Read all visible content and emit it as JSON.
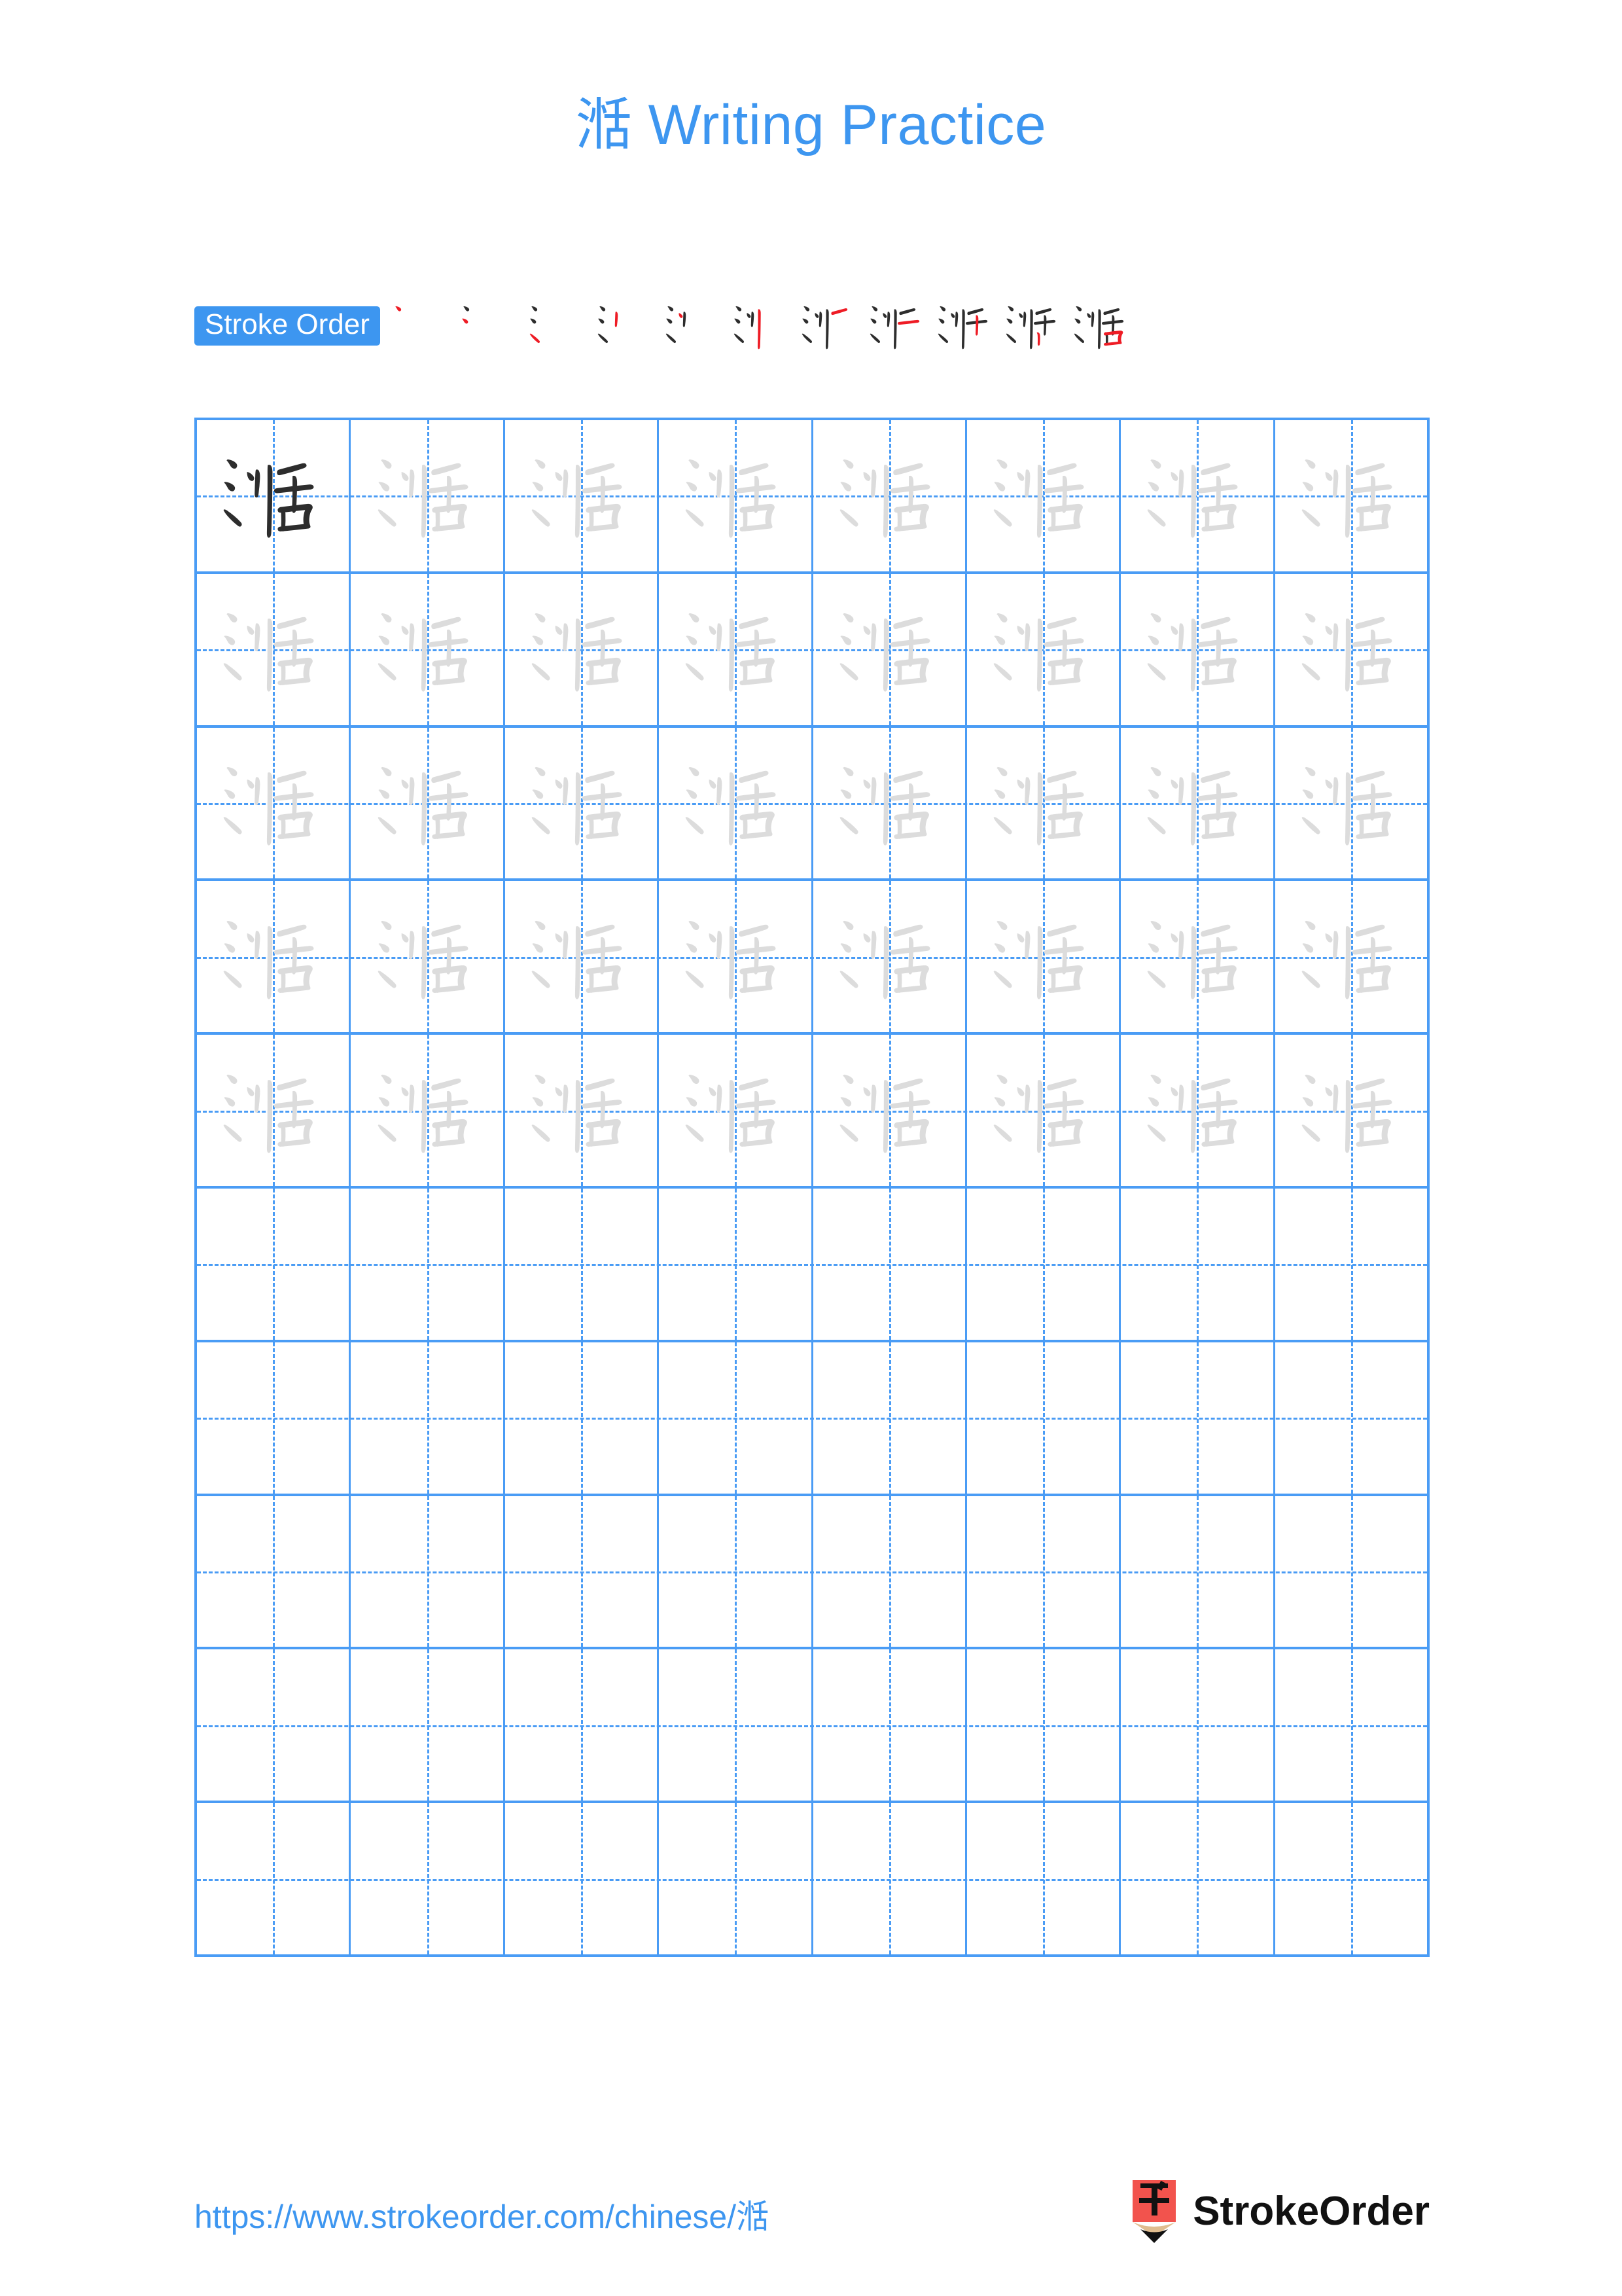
{
  "document": {
    "character": "湉",
    "title": "湉 Writing Practice",
    "title_suffix": " Writing Practice",
    "background_color": "#ffffff",
    "accent_color": "#3d96f0",
    "grid_line_color": "#4a9cf5",
    "trace_char_color": "#dcdcdc",
    "dark_char_color": "#2d2d2d",
    "new_stroke_color": "#ee1c25"
  },
  "stroke_order": {
    "label": "Stroke Order",
    "total_strokes": 11,
    "steps": [
      {
        "index": 1,
        "strokes_shown": 1,
        "new_stroke": 1,
        "label": "stroke-1"
      },
      {
        "index": 2,
        "strokes_shown": 2,
        "new_stroke": 2,
        "label": "stroke-2"
      },
      {
        "index": 3,
        "strokes_shown": 3,
        "new_stroke": 3,
        "label": "stroke-3"
      },
      {
        "index": 4,
        "strokes_shown": 4,
        "new_stroke": 4,
        "label": "stroke-4"
      },
      {
        "index": 5,
        "strokes_shown": 5,
        "new_stroke": 5,
        "label": "stroke-5"
      },
      {
        "index": 6,
        "strokes_shown": 6,
        "new_stroke": 6,
        "label": "stroke-6"
      },
      {
        "index": 7,
        "strokes_shown": 7,
        "new_stroke": 7,
        "label": "stroke-7"
      },
      {
        "index": 8,
        "strokes_shown": 8,
        "new_stroke": 8,
        "label": "stroke-8"
      },
      {
        "index": 9,
        "strokes_shown": 9,
        "new_stroke": 9,
        "label": "stroke-9"
      },
      {
        "index": 10,
        "strokes_shown": 10,
        "new_stroke": 10,
        "label": "stroke-10"
      },
      {
        "index": 11,
        "strokes_shown": 11,
        "new_stroke": 11,
        "label": "stroke-11"
      }
    ]
  },
  "practice_grid": {
    "columns": 8,
    "rows": 10,
    "traced_rows": 5,
    "empty_rows": 5,
    "first_cell_style": "dark",
    "cells": [
      [
        {
          "char": "湉",
          "style": "dark"
        },
        {
          "char": "湉",
          "style": "trace"
        },
        {
          "char": "湉",
          "style": "trace"
        },
        {
          "char": "湉",
          "style": "trace"
        },
        {
          "char": "湉",
          "style": "trace"
        },
        {
          "char": "湉",
          "style": "trace"
        },
        {
          "char": "湉",
          "style": "trace"
        },
        {
          "char": "湉",
          "style": "trace"
        }
      ],
      [
        {
          "char": "湉",
          "style": "trace"
        },
        {
          "char": "湉",
          "style": "trace"
        },
        {
          "char": "湉",
          "style": "trace"
        },
        {
          "char": "湉",
          "style": "trace"
        },
        {
          "char": "湉",
          "style": "trace"
        },
        {
          "char": "湉",
          "style": "trace"
        },
        {
          "char": "湉",
          "style": "trace"
        },
        {
          "char": "湉",
          "style": "trace"
        }
      ],
      [
        {
          "char": "湉",
          "style": "trace"
        },
        {
          "char": "湉",
          "style": "trace"
        },
        {
          "char": "湉",
          "style": "trace"
        },
        {
          "char": "湉",
          "style": "trace"
        },
        {
          "char": "湉",
          "style": "trace"
        },
        {
          "char": "湉",
          "style": "trace"
        },
        {
          "char": "湉",
          "style": "trace"
        },
        {
          "char": "湉",
          "style": "trace"
        }
      ],
      [
        {
          "char": "湉",
          "style": "trace"
        },
        {
          "char": "湉",
          "style": "trace"
        },
        {
          "char": "湉",
          "style": "trace"
        },
        {
          "char": "湉",
          "style": "trace"
        },
        {
          "char": "湉",
          "style": "trace"
        },
        {
          "char": "湉",
          "style": "trace"
        },
        {
          "char": "湉",
          "style": "trace"
        },
        {
          "char": "湉",
          "style": "trace"
        }
      ],
      [
        {
          "char": "湉",
          "style": "trace"
        },
        {
          "char": "湉",
          "style": "trace"
        },
        {
          "char": "湉",
          "style": "trace"
        },
        {
          "char": "湉",
          "style": "trace"
        },
        {
          "char": "湉",
          "style": "trace"
        },
        {
          "char": "湉",
          "style": "trace"
        },
        {
          "char": "湉",
          "style": "trace"
        },
        {
          "char": "湉",
          "style": "trace"
        }
      ],
      [
        {
          "char": "",
          "style": "empty"
        },
        {
          "char": "",
          "style": "empty"
        },
        {
          "char": "",
          "style": "empty"
        },
        {
          "char": "",
          "style": "empty"
        },
        {
          "char": "",
          "style": "empty"
        },
        {
          "char": "",
          "style": "empty"
        },
        {
          "char": "",
          "style": "empty"
        },
        {
          "char": "",
          "style": "empty"
        }
      ],
      [
        {
          "char": "",
          "style": "empty"
        },
        {
          "char": "",
          "style": "empty"
        },
        {
          "char": "",
          "style": "empty"
        },
        {
          "char": "",
          "style": "empty"
        },
        {
          "char": "",
          "style": "empty"
        },
        {
          "char": "",
          "style": "empty"
        },
        {
          "char": "",
          "style": "empty"
        },
        {
          "char": "",
          "style": "empty"
        }
      ],
      [
        {
          "char": "",
          "style": "empty"
        },
        {
          "char": "",
          "style": "empty"
        },
        {
          "char": "",
          "style": "empty"
        },
        {
          "char": "",
          "style": "empty"
        },
        {
          "char": "",
          "style": "empty"
        },
        {
          "char": "",
          "style": "empty"
        },
        {
          "char": "",
          "style": "empty"
        },
        {
          "char": "",
          "style": "empty"
        }
      ],
      [
        {
          "char": "",
          "style": "empty"
        },
        {
          "char": "",
          "style": "empty"
        },
        {
          "char": "",
          "style": "empty"
        },
        {
          "char": "",
          "style": "empty"
        },
        {
          "char": "",
          "style": "empty"
        },
        {
          "char": "",
          "style": "empty"
        },
        {
          "char": "",
          "style": "empty"
        },
        {
          "char": "",
          "style": "empty"
        }
      ],
      [
        {
          "char": "",
          "style": "empty"
        },
        {
          "char": "",
          "style": "empty"
        },
        {
          "char": "",
          "style": "empty"
        },
        {
          "char": "",
          "style": "empty"
        },
        {
          "char": "",
          "style": "empty"
        },
        {
          "char": "",
          "style": "empty"
        },
        {
          "char": "",
          "style": "empty"
        },
        {
          "char": "",
          "style": "empty"
        }
      ]
    ]
  },
  "footer": {
    "url": "https://www.strokeorder.com/chinese/湉",
    "brand_name": "StrokeOrder",
    "logo_icon": "pencil-logo-icon",
    "logo_char": "字",
    "logo_body_color": "#f2534d",
    "logo_wood_color": "#e0bd8f",
    "logo_tip_color": "#111111"
  }
}
